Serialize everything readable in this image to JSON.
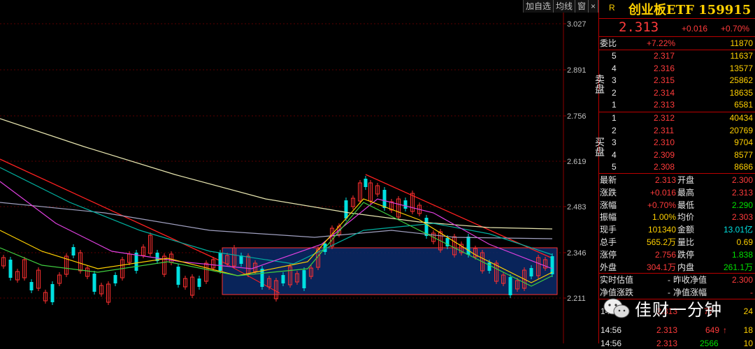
{
  "toolbar": {
    "add_watchlist": "加自选",
    "ma_lines": "均线",
    "window": "窗",
    "close": "×"
  },
  "price_axis": [
    "3.027",
    "2.891",
    "2.756",
    "2.619",
    "2.483",
    "2.346",
    "2.211"
  ],
  "header": {
    "badge": "R",
    "name": "创业板ETF 159915"
  },
  "quote": {
    "last": "2.313",
    "change": "+0.016",
    "change_pct": "+0.70%"
  },
  "weibi": {
    "label": "委比",
    "pct": "+7.22%",
    "diff": "11870"
  },
  "sell_label": "卖盘",
  "buy_label": "买盘",
  "asks": [
    {
      "level": "5",
      "price": "2.317",
      "vol": "11637"
    },
    {
      "level": "4",
      "price": "2.316",
      "vol": "13577"
    },
    {
      "level": "3",
      "price": "2.315",
      "vol": "25862"
    },
    {
      "level": "2",
      "price": "2.314",
      "vol": "18635"
    },
    {
      "level": "1",
      "price": "2.313",
      "vol": "6581"
    }
  ],
  "bids": [
    {
      "level": "1",
      "price": "2.312",
      "vol": "40434"
    },
    {
      "level": "2",
      "price": "2.311",
      "vol": "20769"
    },
    {
      "level": "3",
      "price": "2.310",
      "vol": "9704"
    },
    {
      "level": "4",
      "price": "2.309",
      "vol": "8577"
    },
    {
      "level": "5",
      "price": "2.308",
      "vol": "8686"
    }
  ],
  "stats": [
    {
      "l1": "最新",
      "v1": "2.313",
      "l2": "开盘",
      "v2": "2.300",
      "c1": "red",
      "c2": "red"
    },
    {
      "l1": "涨跌",
      "v1": "+0.016",
      "l2": "最高",
      "v2": "2.313",
      "c1": "red",
      "c2": "red"
    },
    {
      "l1": "涨幅",
      "v1": "+0.70%",
      "l2": "最低",
      "v2": "2.290",
      "c1": "red",
      "c2": "green"
    },
    {
      "l1": "振幅",
      "v1": "1.00%",
      "l2": "均价",
      "v2": "2.303",
      "c1": "yellow",
      "c2": "red"
    },
    {
      "l1": "现手",
      "v1": "101340",
      "l2": "金额",
      "v2": "13.01亿",
      "c1": "yellow",
      "c2": "cyan"
    },
    {
      "l1": "总手",
      "v1": "565.2万",
      "l2": "量比",
      "v2": "0.69",
      "c1": "yellow",
      "c2": "yellow"
    },
    {
      "l1": "涨停",
      "v1": "2.756",
      "l2": "跌停",
      "v2": "1.838",
      "c1": "red",
      "c2": "green"
    },
    {
      "l1": "外盘",
      "v1": "304.1万",
      "l2": "内盘",
      "v2": "261.1万",
      "c1": "red",
      "c2": "green"
    }
  ],
  "nav": [
    {
      "l1": "实时估值",
      "v1": "-",
      "l2": "昨收净值",
      "v2": "2.300"
    },
    {
      "l1": "净值涨跌",
      "v1": "-",
      "l2": "净值涨幅",
      "v2": "-"
    }
  ],
  "ticks": [
    {
      "time": "14:56",
      "price": "2.313",
      "vol": "649",
      "arrow": "↑",
      "num": "18"
    }
  ],
  "partial": {
    "r1_time": "14:5",
    "r1_price": "2.313",
    "r1_vol": "77",
    "r1_num": "24",
    "r3_time": "14:56",
    "r3_price": "2.313",
    "r3_vol": "2566",
    "r3_num": "10"
  },
  "watermark": "佳财一分钟"
}
